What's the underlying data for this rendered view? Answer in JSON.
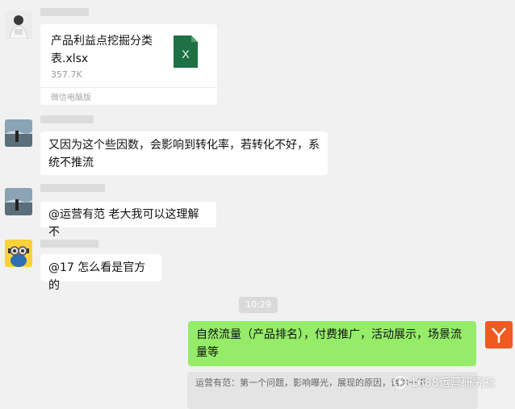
{
  "messages": {
    "file": {
      "name": "产品利益点挖掘分类表.xlsx",
      "size": "357.7K",
      "source": "微信电脑版",
      "icon": "excel-file-icon",
      "icon_letter": "X",
      "icon_color": "#1e7145"
    },
    "msg2": "又因为这个些因数，会影响到转化率，若转化不好，系统不推流",
    "msg3": "@运营有范 老大我可以这理解不",
    "msg4": "@17 怎么看是官方的",
    "time": "10:29",
    "msg5": "自然流量（产品排名），付费推广，活动展示，场景流量等",
    "quote": "运营有范：第一个问题，影响曝光，展现的原因，请你一下",
    "self_avatar_color": "#f05a22"
  },
  "watermark": {
    "text": "1688运营研究社",
    "icon": "wechat-official-account-icon"
  },
  "colors": {
    "background": "#f1f1f1",
    "bubble_other": "#ffffff",
    "bubble_self": "#95ec69"
  }
}
